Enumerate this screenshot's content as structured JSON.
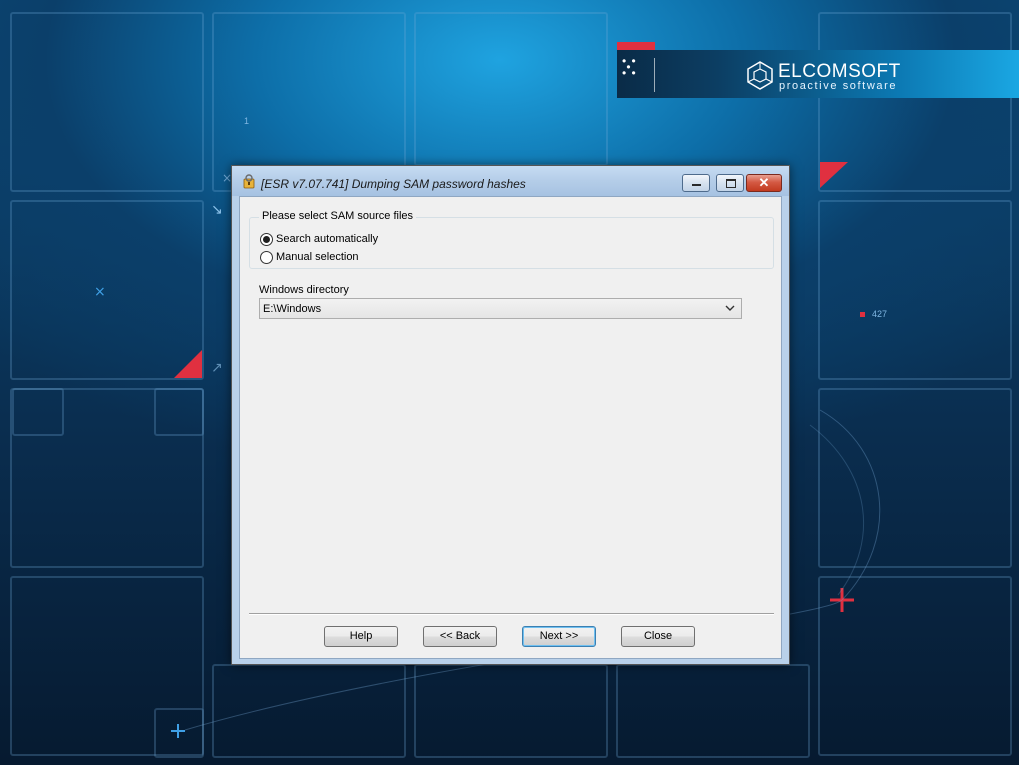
{
  "window": {
    "title": "[ESR v7.07.741]  Dumping SAM password hashes"
  },
  "sam_source": {
    "label": "Please select SAM source files",
    "options": [
      {
        "label": "Search automatically",
        "selected": true
      },
      {
        "label": "Manual selection",
        "selected": false
      }
    ]
  },
  "windows_directory": {
    "label": "Windows directory",
    "value": "E:\\Windows"
  },
  "buttons": {
    "help": "Help",
    "back": "<< Back",
    "next": "Next >>",
    "close": "Close"
  },
  "branding": {
    "name": "ELCOMSOFT",
    "tagline": "proactive software",
    "hud_number": "427",
    "hud_digit": "1"
  },
  "colors": {
    "accent_red": "#e03040",
    "brand_blue": "#1aa7e3",
    "window_frame": "#b9d1ea"
  }
}
